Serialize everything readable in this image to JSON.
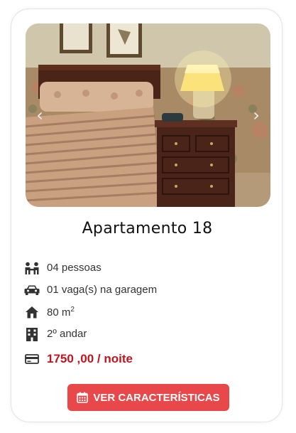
{
  "card": {
    "title": "Apartamento 18",
    "features": {
      "people": "04 pessoas",
      "parking": "01 vaga(s) na garagem",
      "area": "80 m",
      "area_unit_sup": "2",
      "floor": "2º andar"
    },
    "price": "1750 ,00 / noite",
    "button_label": "VER CARACTERÍSTICAS",
    "carousel": {
      "prev": "‹",
      "next": "›"
    }
  },
  "icons": {
    "people": "people-icon",
    "car": "car-icon",
    "home": "home-icon",
    "building": "building-icon",
    "card": "credit-card-icon",
    "calendar": "calendar-icon"
  },
  "colors": {
    "price": "#c0141e",
    "button": "#e9484a",
    "icon": "#333333"
  }
}
